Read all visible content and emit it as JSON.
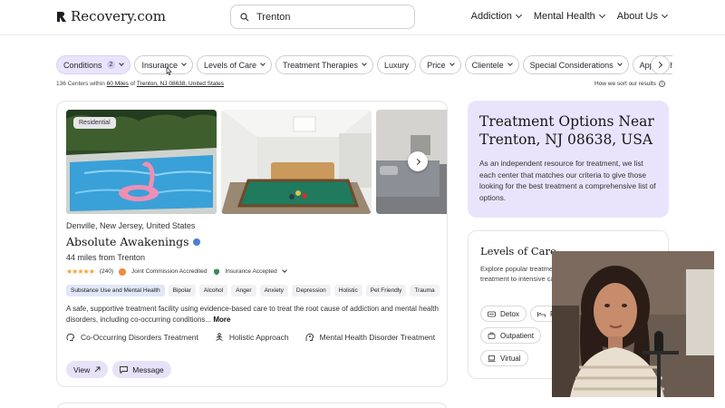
{
  "header": {
    "logo_text": "Recovery.com",
    "search_value": "Trenton",
    "nav": [
      "Addiction",
      "Mental Health",
      "About Us"
    ]
  },
  "filters": {
    "chips": [
      {
        "label": "Conditions",
        "count": "2",
        "active": true
      },
      {
        "label": "Insurance"
      },
      {
        "label": "Levels of Care"
      },
      {
        "label": "Treatment Therapies"
      },
      {
        "label": "Luxury",
        "no_chevron": true
      },
      {
        "label": "Price"
      },
      {
        "label": "Clientele"
      },
      {
        "label": "Special Considerations"
      },
      {
        "label": "Approach"
      }
    ]
  },
  "results": {
    "count_text": "136 Centers within",
    "radius": "60 Miles",
    "of_text": "of",
    "location": "Trenton, NJ 08638, United States",
    "sort_link": "How we sort our results"
  },
  "listing": {
    "badge": "Residential",
    "location": "Denville, New Jersey, United States",
    "name": "Absolute Awakenings",
    "distance": "44 miles from Trenton",
    "rating_count": "(240)",
    "accreditation": "Joint Commission Accredited",
    "insurance": "Insurance Accepted",
    "tags": [
      "Substance Use and Mental Health",
      "Bipolar",
      "Alcohol",
      "Anger",
      "Anxiety",
      "Depression",
      "Holistic",
      "Pet Friendly",
      "Trauma"
    ],
    "description_1": "A safe, supportive treatment facility using evidence-based care to treat the root cause of addiction and mental health",
    "description_2": "disorders, including co-occurring conditions...",
    "more": "More",
    "features": [
      "Co-Occurring Disorders Treatment",
      "Holistic Approach",
      "Mental Health Disorder Treatment"
    ],
    "view_label": "View",
    "message_label": "Message"
  },
  "treatment_panel": {
    "title": "Treatment Options Near Trenton, NJ 08638, USA",
    "description": "As an independent resource for treatment, we list each center that matches our criteria to give those looking for the best treatment a comprehensive list of options."
  },
  "levels_panel": {
    "title": "Levels of Care",
    "description": "Explore popular treatment options, ranging from flexible treatment to intensive care in Residential",
    "pills": [
      "Detox",
      "R",
      "Outpatient",
      "Virtual"
    ]
  },
  "colors": {
    "accent_lavender": "#e9e4fb",
    "chip_active": "#e9e4fb",
    "star": "#f2a33a",
    "verified": "#4a7fd8"
  }
}
